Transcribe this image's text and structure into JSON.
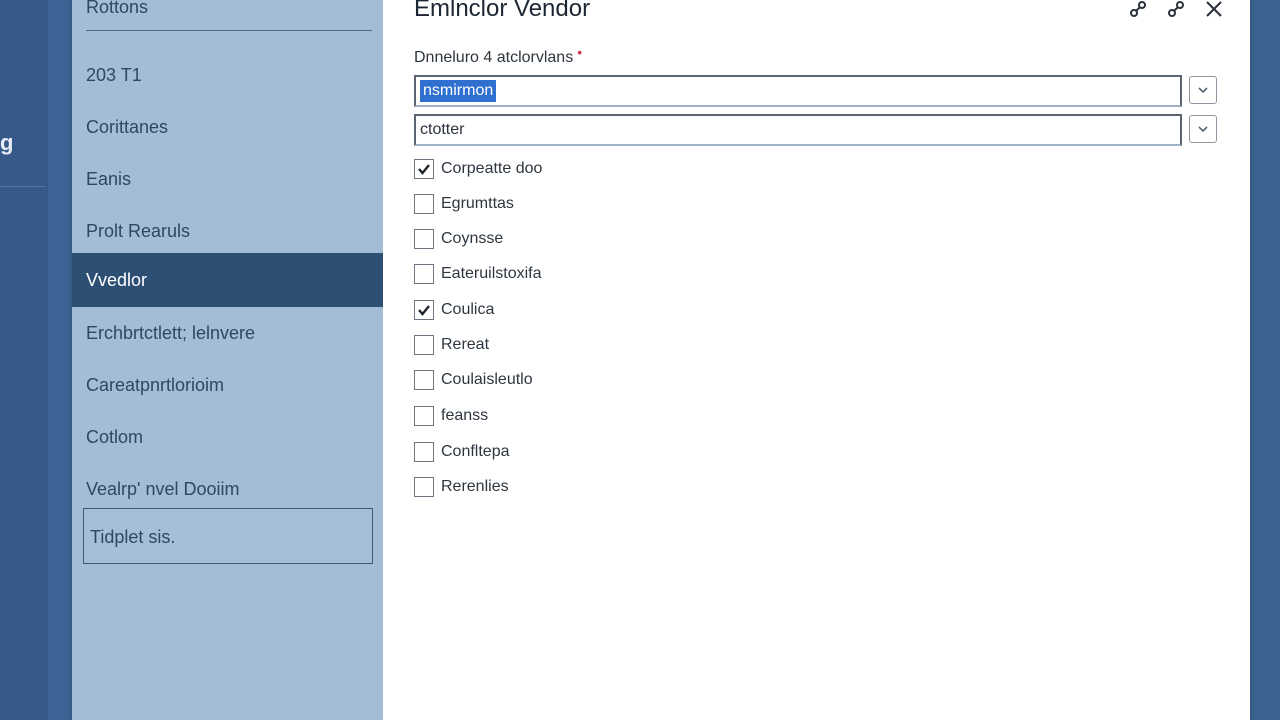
{
  "sidebar": {
    "header": "Rottons",
    "items": [
      {
        "label": "203 T1",
        "active": false
      },
      {
        "label": "Corittanes",
        "active": false
      },
      {
        "label": "Eanis",
        "active": false
      },
      {
        "label": "Prolt Rearuls",
        "active": false
      },
      {
        "label": "Vvedlor",
        "active": true
      },
      {
        "label": "Erchbrtctlett; lelnvere",
        "active": false
      },
      {
        "label": "Careatpnrtlorioim",
        "active": false
      },
      {
        "label": "Cotlom",
        "active": false
      },
      {
        "label": "Vealrp' nvel Dooiim",
        "active": false
      },
      {
        "label": "Tidplet sis.",
        "active": false,
        "boxed": true
      }
    ]
  },
  "dialog": {
    "title": "Emlnclor Vendor",
    "field_label": "Dnneluro 4 atclorvlans",
    "required_mark": "•",
    "select_primary": {
      "value": "nsmirmon"
    },
    "select_secondary": {
      "value": "ctotter"
    },
    "checkboxes": [
      {
        "label": "Corpeatte doo",
        "checked": true
      },
      {
        "label": "Egrumttas",
        "checked": false
      },
      {
        "label": "Coynsse",
        "checked": false
      },
      {
        "label": "Eateruilstoxifa",
        "checked": false
      },
      {
        "label": "Coulica",
        "checked": true
      },
      {
        "label": "Rereat",
        "checked": false
      },
      {
        "label": "Coulaisleutlo",
        "checked": false
      },
      {
        "label": "feanss",
        "checked": false
      },
      {
        "label": "Confltepa",
        "checked": false
      },
      {
        "label": "Rerenlies",
        "checked": false
      }
    ]
  },
  "backdrop": {
    "glyph": "g"
  },
  "colors": {
    "sidebar_bg": "#a4bcd6",
    "active_item_bg": "#2e4f74",
    "selection_highlight": "#2f6fcf",
    "required_mark": "#d23a4a",
    "backdrop": "#3b6190"
  },
  "icons": {
    "title_action_1": "link-icon",
    "title_action_2": "link-icon",
    "close": "close-icon",
    "dropdown": "chevron-down-icon",
    "check": "checkmark-icon"
  }
}
